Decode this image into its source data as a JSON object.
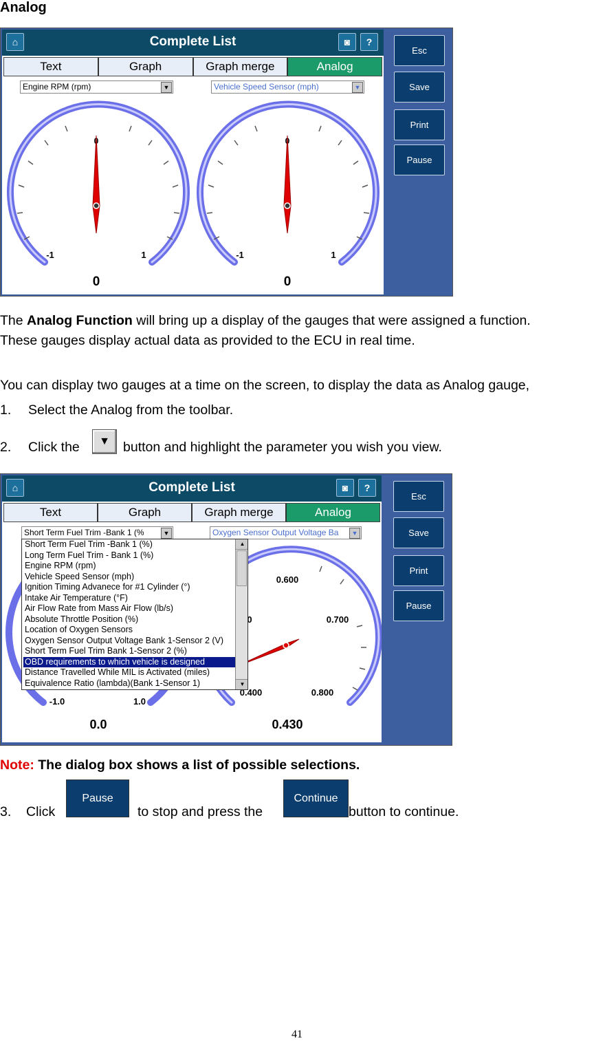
{
  "heading": "Analog",
  "screen1": {
    "title": "Complete List",
    "tabs": [
      "Text",
      "Graph",
      "Graph merge",
      "Analog"
    ],
    "dropdown_left": "Engine RPM (rpm)",
    "dropdown_right": "Vehicle Speed Sensor (mph)",
    "gauge_left": {
      "min_label": "-1",
      "max_label": "1",
      "top_label": "0",
      "value": "0"
    },
    "gauge_right": {
      "min_label": "-1",
      "max_label": "1",
      "top_label": "0",
      "value": "0"
    },
    "buttons": [
      "Esc",
      "Save",
      "Print",
      "Pause"
    ]
  },
  "para1_prefix": "The ",
  "para1_bold": "Analog Function",
  "para1_suffix": " will bring up a display of the gauges that were assigned a function.",
  "para2": "These gauges display actual data as provided to the ECU in real time.",
  "para3": "You can display two gauges at a time on the screen, to display the data as Analog gauge,",
  "step1_num": "1.",
  "step1": "Select the Analog from the toolbar.",
  "step2_num": "2.",
  "step2_pre": "Click the",
  "step2_post": "button and highlight the parameter you wish you view.",
  "screen2": {
    "title": "Complete List",
    "tabs": [
      "Text",
      "Graph",
      "Graph merge",
      "Analog"
    ],
    "dropdown_left": "Short Term Fuel Trim -Bank 1 (%",
    "dropdown_right": "Oxygen Sensor Output Voltage Ba",
    "list_items": [
      "Short Term Fuel Trim -Bank 1 (%)",
      "Long Term Fuel Trim - Bank 1 (%)",
      "Engine RPM (rpm)",
      "Vehicle Speed Sensor (mph)",
      "Ignition Timing Advanece for #1 Cylinder (°)",
      "Intake Air Temperature (°F)",
      "Air Flow Rate from Mass Air Flow (lb/s)",
      "Absolute Throttle Position (%)",
      "Location of Oxygen Sensors",
      "Oxygen Sensor Output Voltage Bank 1-Sensor 2 (V)",
      "Short Term Fuel Trim Bank 1-Sensor 2 (%)",
      "OBD requirements to which vehicle is designed",
      "Distance Travelled While MIL is Activated (miles)",
      "Equivalence Ratio (lambda)(Bank 1-Sensor 1)"
    ],
    "selected_index": 11,
    "gauge_left": {
      "min_label": "-1.0",
      "max_label": "1.0",
      "value": "0.0"
    },
    "gauge_right": {
      "labels": [
        "0.600",
        "0.700",
        "0.800",
        "0.400"
      ],
      "partial_label": "0",
      "value": "0.430"
    },
    "buttons": [
      "Esc",
      "Save",
      "Print",
      "Pause"
    ]
  },
  "note_label": "Note:",
  "note_text": " The dialog box shows a list of possible selections.",
  "step3_num": "3.",
  "step3_pre": "Click",
  "step3_btn1": "Pause",
  "step3_mid": "to stop and press the",
  "step3_btn2": "Continue",
  "step3_post": "button to continue.",
  "page_number": "41",
  "colors": {
    "titlebar": "#0d4a66",
    "active_tab": "#1b9a6a",
    "sidebar": "#3d5f9f",
    "button": "#0b3d6e",
    "gauge_ring": "#8a8ef0",
    "needle": "#e00000",
    "note": "#e00000"
  }
}
